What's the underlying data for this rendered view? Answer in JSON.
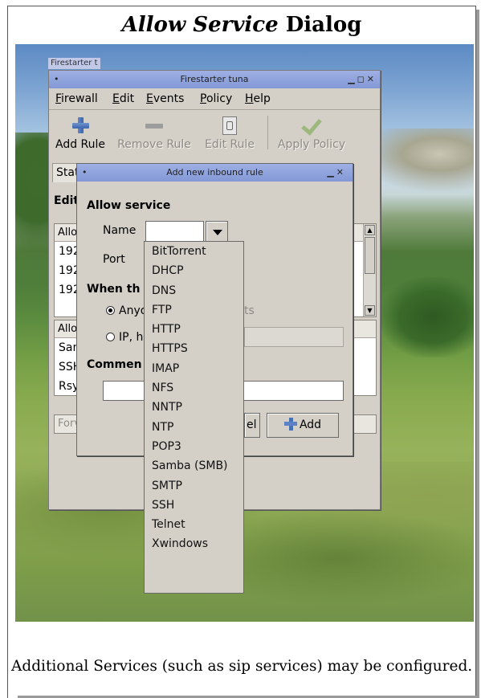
{
  "page": {
    "title_em": "Allow Service",
    "title_rest": " Dialog",
    "caption": "Additional Services (such as sip services) may be configured."
  },
  "taskbar": {
    "label": "Firestarter t"
  },
  "main_window": {
    "title": "Firestarter tuna",
    "menu": [
      "Firewall",
      "Edit",
      "Events",
      "Policy",
      "Help"
    ],
    "toolbar": {
      "add_rule": "Add Rule",
      "remove_rule": "Remove Rule",
      "edit_rule": "Edit Rule",
      "apply_policy": "Apply Policy"
    },
    "tab_status_partial": "Stat",
    "section_partial": "Edit",
    "list1": {
      "header_partial": "Allov",
      "rows": [
        "192",
        "192",
        "192"
      ]
    },
    "list2": {
      "header_partial": "Allov",
      "rows": [
        "San",
        "SSH",
        "Rsy"
      ]
    },
    "list3_header_partial": "Forv"
  },
  "dialog": {
    "title": "Add new inbound rule",
    "heading": "Allow service",
    "name_label": "Name",
    "port_label": "Port",
    "when_label_partial": "When th",
    "radio_anyone_partial": "Anyo",
    "hosts_partial": "ts",
    "radio_ip_partial": "IP, h",
    "comment_label_partial": "Commen",
    "cancel_partial": "el",
    "add_label": "Add"
  },
  "service_options": [
    "BitTorrent",
    "DHCP",
    "DNS",
    "FTP",
    "HTTP",
    "HTTPS",
    "IMAP",
    "NFS",
    "NNTP",
    "NTP",
    "POP3",
    "Samba (SMB)",
    "SMTP",
    "SSH",
    "Telnet",
    "Xwindows"
  ],
  "icons": {
    "add_rule": "plus-icon",
    "remove_rule": "minus-icon",
    "edit_rule": "edit-icon",
    "apply_policy": "check-icon",
    "dropdown": "chevron-down-icon"
  }
}
